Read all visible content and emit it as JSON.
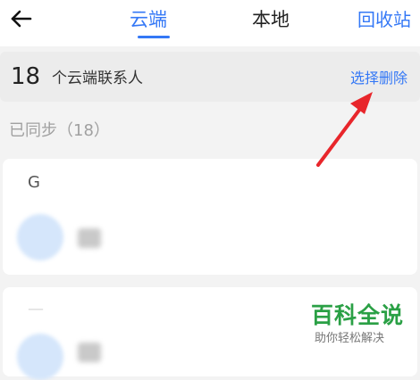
{
  "header": {
    "back_icon": "back-arrow-icon",
    "tabs": [
      {
        "label": "云端",
        "active": true
      },
      {
        "label": "本地",
        "active": false
      }
    ],
    "recycle_label": "回收站"
  },
  "count_bar": {
    "count": "18",
    "label": "个云端联系人",
    "select_delete_label": "选择删除"
  },
  "section": {
    "synced_label": "已同步（18）"
  },
  "groups": [
    {
      "letter": "G"
    }
  ],
  "annotation": {
    "arrow_color": "#e8262b",
    "arrow_icon": "red-arrow-annotation"
  },
  "watermark": {
    "title": "百科全说",
    "subtitle": "助你轻松解决"
  },
  "colors": {
    "accent": "#3478f6",
    "watermark_green": "#2aa045"
  }
}
